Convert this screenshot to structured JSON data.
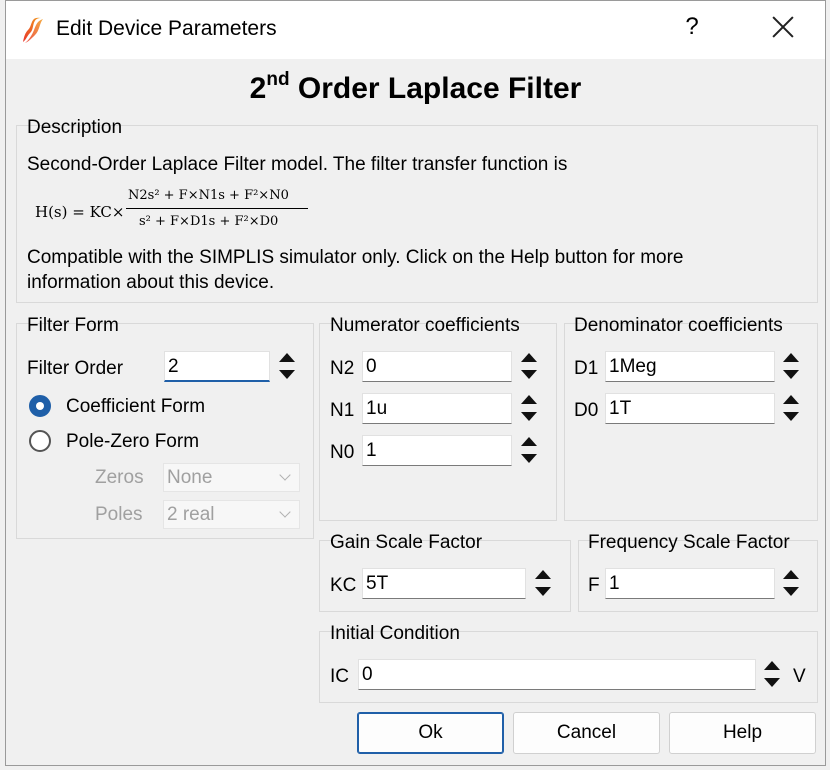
{
  "window": {
    "title": "Edit Device Parameters",
    "help_glyph": "?"
  },
  "heading": {
    "prefix": "2",
    "superscript": "nd",
    "suffix": " Order Laplace Filter"
  },
  "description": {
    "group_title": "Description",
    "line1": "Second-Order Laplace Filter model. The filter transfer function is",
    "formula_lhs": "H(s) = KC×",
    "formula_numerator": "N2s² + F×N1s + F²×N0",
    "formula_denominator": "s² + F×D1s + F²×D0",
    "line2": "Compatible with the SIMPLIS simulator only. Click on the Help button for more",
    "line3": "information about this device."
  },
  "filter_form": {
    "group_title": "Filter Form",
    "order_label": "Filter Order",
    "order_value": "2",
    "coefficient_form_label": "Coefficient Form",
    "coefficient_form_selected": true,
    "pole_zero_form_label": "Pole-Zero Form",
    "zeros_label": "Zeros",
    "zeros_value": "None",
    "poles_label": "Poles",
    "poles_value": "2 real"
  },
  "numerator": {
    "group_title": "Numerator coefficients",
    "n2_label": "N2",
    "n2_value": "0",
    "n1_label": "N1",
    "n1_value": "1u",
    "n0_label": "N0",
    "n0_value": "1"
  },
  "denominator": {
    "group_title": "Denominator coefficients",
    "d1_label": "D1",
    "d1_value": "1Meg",
    "d0_label": "D0",
    "d0_value": "1T"
  },
  "gain": {
    "group_title": "Gain Scale Factor",
    "kc_label": "KC",
    "kc_value": "5T"
  },
  "frequency": {
    "group_title": "Frequency Scale Factor",
    "f_label": "F",
    "f_value": "1"
  },
  "initial_condition": {
    "group_title": "Initial Condition",
    "ic_label": "IC",
    "ic_value": "0",
    "unit": "V"
  },
  "buttons": {
    "ok": "Ok",
    "cancel": "Cancel",
    "help": "Help"
  },
  "colors": {
    "accent": "#1f5fa8",
    "icon_red": "#e8342a",
    "icon_orange": "#f29a1e"
  }
}
